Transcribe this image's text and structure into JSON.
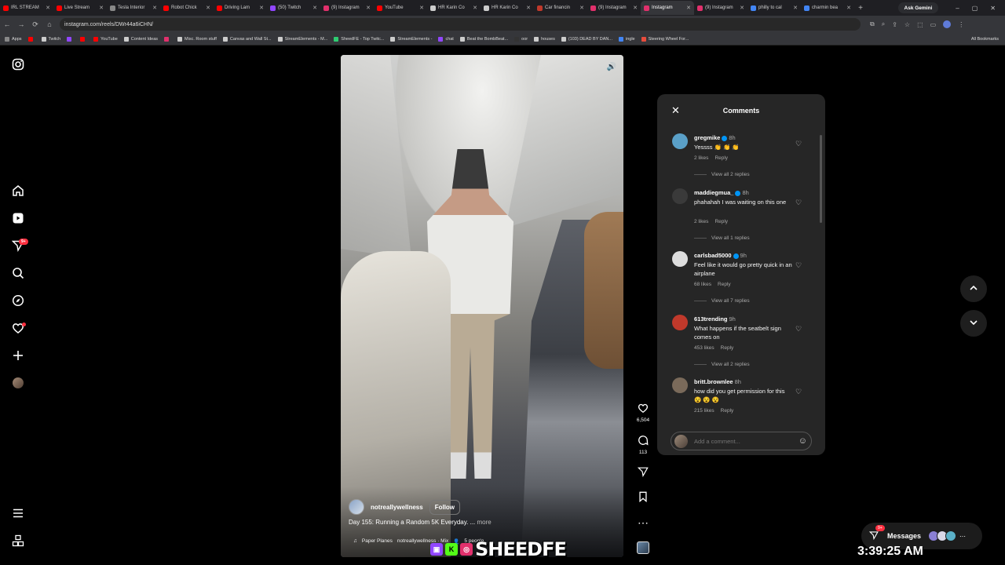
{
  "browser": {
    "tabs": [
      {
        "label": "IRL STREAM",
        "fav": "#ff0000"
      },
      {
        "label": "Live Stream",
        "fav": "#ff0000"
      },
      {
        "label": "Tesla Interior",
        "fav": "#888888"
      },
      {
        "label": "Robot Chick",
        "fav": "#ff0000"
      },
      {
        "label": "Driving Lam",
        "fav": "#ff0000"
      },
      {
        "label": "(50) Twitch",
        "fav": "#9146ff"
      },
      {
        "label": "(9) Instagram",
        "fav": "#e1306c"
      },
      {
        "label": "YouTube",
        "fav": "#ff0000"
      },
      {
        "label": "HR Karin Co",
        "fav": "#cccccc"
      },
      {
        "label": "HR Karin Co",
        "fav": "#cccccc"
      },
      {
        "label": "Car financin",
        "fav": "#c0392b"
      },
      {
        "label": "(9) Instagram",
        "fav": "#e1306c"
      },
      {
        "label": "Instagram",
        "fav": "#e1306c"
      },
      {
        "label": "(9) Instagram",
        "fav": "#e1306c"
      },
      {
        "label": "philly to cal",
        "fav": "#4285f4"
      },
      {
        "label": "charmin bea",
        "fav": "#4285f4"
      }
    ],
    "active_tab_index": 12,
    "ask_gemini": "Ask Gemini",
    "url": "instagram.com/reels/DWr44a6iCHN/",
    "bookmarks": [
      {
        "label": "Apps",
        "fav": "#888888"
      },
      {
        "label": "",
        "fav": "#ff0000"
      },
      {
        "label": "Twitch",
        "fav": "#cccccc"
      },
      {
        "label": "",
        "fav": "#9146ff"
      },
      {
        "label": "",
        "fav": "#ff0000"
      },
      {
        "label": "YouTube",
        "fav": "#ff0000"
      },
      {
        "label": "Content Ideas",
        "fav": "#cccccc"
      },
      {
        "label": "",
        "fav": "#e1306c"
      },
      {
        "label": "Misc. Room stuff",
        "fav": "#cccccc"
      },
      {
        "label": "Canvas and Wall St...",
        "fav": "#cccccc"
      },
      {
        "label": "StreamElements - M...",
        "fav": "#cccccc"
      },
      {
        "label": "SheedFE - Top Twitc...",
        "fav": "#2ecc71"
      },
      {
        "label": "StreamElements -",
        "fav": "#cccccc"
      },
      {
        "label": "chat",
        "fav": "#9146ff"
      },
      {
        "label": "Beat the BombBeat...",
        "fav": "#cccccc"
      },
      {
        "label": "oor",
        "fav": "#333333"
      },
      {
        "label": "houses",
        "fav": "#cccccc"
      },
      {
        "label": "(103) DEAD BY DAN...",
        "fav": "#cccccc"
      },
      {
        "label": "ingle",
        "fav": "#4285f4"
      },
      {
        "label": "Steering Wheel For...",
        "fav": "#e74c3c"
      }
    ],
    "all_bookmarks": "All Bookmarks"
  },
  "sidebar": {
    "notifications_badge": "9+"
  },
  "reel": {
    "author": "notreallywellness",
    "follow_label": "Follow",
    "caption": "Day 155: Running a Random 5K Everyday. ...",
    "more_label": "more",
    "music": "Paper Planes",
    "music_artist": "notreallywellness · Mix",
    "people": "5 people",
    "likes": "6,504",
    "comments_count": "113"
  },
  "comments_panel": {
    "title": "Comments",
    "comments": [
      {
        "user": "gregmike",
        "verified": true,
        "time": "8h",
        "text": "Yessss 👏 👏 👏",
        "likes": "2 likes",
        "reply": "Reply",
        "view_replies": "View all 2 replies",
        "avatar": "#5aa0c8"
      },
      {
        "user": "maddiegmua_",
        "verified": true,
        "time": "8h",
        "text": "phahahah I was waiting on this one",
        "likes": "2 likes",
        "reply": "Reply",
        "view_replies": "View all 1 replies",
        "avatar": "#3a3a3a"
      },
      {
        "user": "carlsbad5000",
        "verified": true,
        "time": "9h",
        "text": "Feel like it would go pretty quick in an airplane",
        "likes": "68 likes",
        "reply": "Reply",
        "view_replies": "View all 7 replies",
        "avatar": "#dddddd"
      },
      {
        "user": "613trending",
        "verified": false,
        "time": "9h",
        "text": "What happens if the seatbelt sign comes on",
        "likes": "453 likes",
        "reply": "Reply",
        "view_replies": "View all 2 replies",
        "avatar": "#c0392b"
      },
      {
        "user": "britt.brownlee",
        "verified": false,
        "time": "8h",
        "text": "how did you get permission for this 😵 😵 😵",
        "likes": "215 likes",
        "reply": "Reply",
        "view_replies": "",
        "avatar": "#7a6a5a"
      }
    ],
    "input_placeholder": "Add a comment..."
  },
  "messages": {
    "label": "Messages",
    "badge": "9+"
  },
  "overlay": {
    "text": "SHEEDFE",
    "clock": "3:39:25 AM"
  },
  "colors": {
    "accent_badge": "#ff3040",
    "verified": "#0095f6",
    "panel_bg": "#262626"
  }
}
